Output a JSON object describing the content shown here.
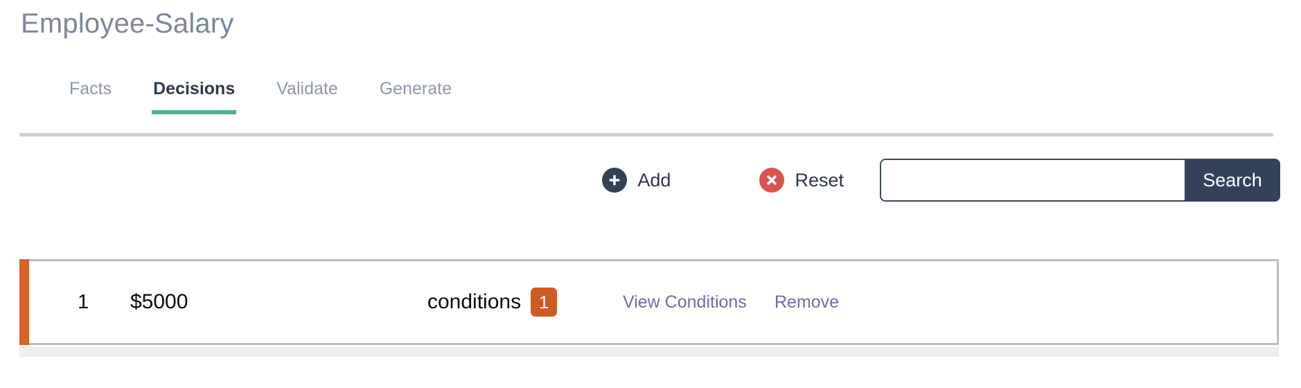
{
  "header": {
    "title": "Employee-Salary"
  },
  "tabs": [
    {
      "label": "Facts",
      "active": false
    },
    {
      "label": "Decisions",
      "active": true
    },
    {
      "label": "Validate",
      "active": false
    },
    {
      "label": "Generate",
      "active": false
    }
  ],
  "toolbar": {
    "add_label": "Add",
    "add_icon": "circle-plus-icon",
    "reset_label": "Reset",
    "reset_icon": "circle-x-icon",
    "search": {
      "value": "",
      "placeholder": "",
      "button_label": "Search"
    }
  },
  "results": {
    "rows": [
      {
        "index": "1",
        "value": "$5000",
        "conditions_label": "conditions",
        "conditions_count": "1",
        "view_label": "View Conditions",
        "remove_label": "Remove"
      }
    ]
  },
  "colors": {
    "title": "#78889c",
    "tab_active": "#2c3a4b",
    "tab_inactive": "#8a98ac",
    "tab_underline": "#4cb193",
    "add_icon_bg": "#334155",
    "reset_icon_bg": "#d9534f",
    "search_button_bg": "#33425a",
    "row_accent": "#d5632a",
    "badge_bg": "#cf5a22",
    "link": "#6e6ba8",
    "divider": "#cfd1d3"
  }
}
